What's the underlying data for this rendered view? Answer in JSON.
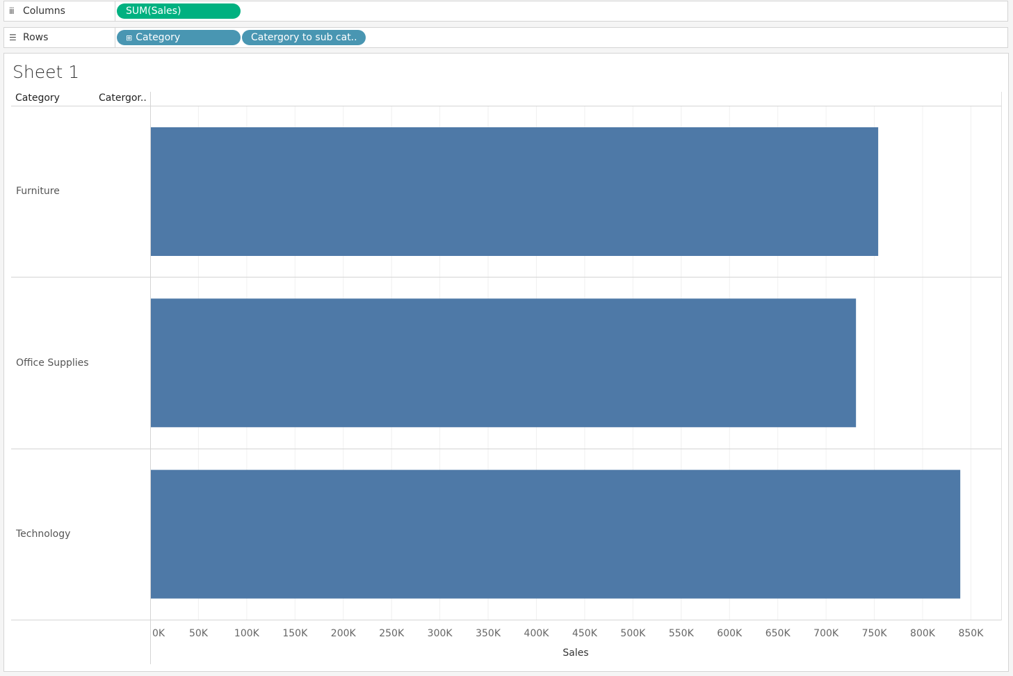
{
  "shelves": {
    "columns": {
      "label": "Columns",
      "icon": "columns-icon",
      "pills": [
        "SUM(Sales)"
      ]
    },
    "rows": {
      "label": "Rows",
      "icon": "rows-icon",
      "pills": [
        "Category",
        "Catergory to sub cat.."
      ]
    }
  },
  "colors": {
    "measure_pill": "#00b180",
    "dimension_pill": "#4996b2",
    "bar": "#4e79a7"
  },
  "sheet": {
    "title": "Sheet 1",
    "headers": [
      "Category",
      "Catergor.."
    ]
  },
  "chart_data": {
    "type": "bar",
    "orientation": "horizontal",
    "categories": [
      "Furniture",
      "Office Supplies",
      "Technology"
    ],
    "values": [
      754000,
      731000,
      839000
    ],
    "xlabel": "Sales",
    "ylabel": "Category",
    "xlim": [
      0,
      880000
    ],
    "ticks": [
      0,
      50000,
      100000,
      150000,
      200000,
      250000,
      300000,
      350000,
      400000,
      450000,
      500000,
      550000,
      600000,
      650000,
      700000,
      750000,
      800000,
      850000
    ],
    "tick_labels": [
      "0K",
      "50K",
      "100K",
      "150K",
      "200K",
      "250K",
      "300K",
      "350K",
      "400K",
      "450K",
      "500K",
      "550K",
      "600K",
      "650K",
      "700K",
      "750K",
      "800K",
      "850K"
    ],
    "grid": true
  }
}
